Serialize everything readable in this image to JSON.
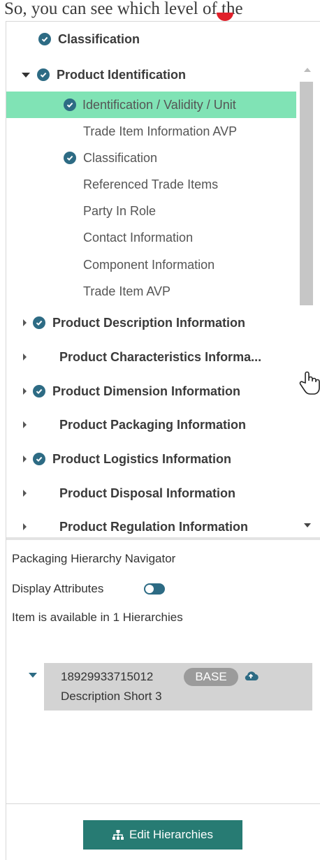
{
  "caption": {
    "text": "So, you can see which level of the"
  },
  "tree": {
    "top_item": {
      "label": "Classification"
    },
    "product_identification": {
      "label": "Product Identification",
      "children": [
        {
          "label": "Identification / Validity / Unit"
        },
        {
          "label": "Trade Item Information AVP"
        },
        {
          "label": "Classification"
        },
        {
          "label": "Referenced Trade Items"
        },
        {
          "label": "Party In Role"
        },
        {
          "label": "Contact Information"
        },
        {
          "label": "Component Information"
        },
        {
          "label": "Trade Item AVP"
        }
      ]
    },
    "sections": [
      {
        "label": "Product Description Information"
      },
      {
        "label": "Product Characteristics Informa..."
      },
      {
        "label": "Product Dimension Information"
      },
      {
        "label": "Product Packaging Information"
      },
      {
        "label": "Product Logistics Information"
      },
      {
        "label": "Product Disposal Information"
      },
      {
        "label": "Product Regulation Information"
      }
    ]
  },
  "navigator": {
    "title": "Packaging Hierarchy Navigator",
    "display_attributes_label": "Display Attributes",
    "availability": "Item is available in 1 Hierarchies",
    "item": {
      "code": "18929933715012",
      "badge": "BASE",
      "description": "Description Short 3"
    },
    "edit_button": "Edit Hierarchies"
  },
  "colors": {
    "selected_row": "#80e3b5",
    "check_icon": "#2d6b84",
    "edit_button": "#277b73",
    "badge": "#9b9b9b"
  },
  "icons": [
    "check-circle-icon",
    "caret-down-icon",
    "caret-right-icon",
    "toggle-icon",
    "cloud-upload-icon",
    "sitemap-icon",
    "hand-cursor-icon"
  ]
}
